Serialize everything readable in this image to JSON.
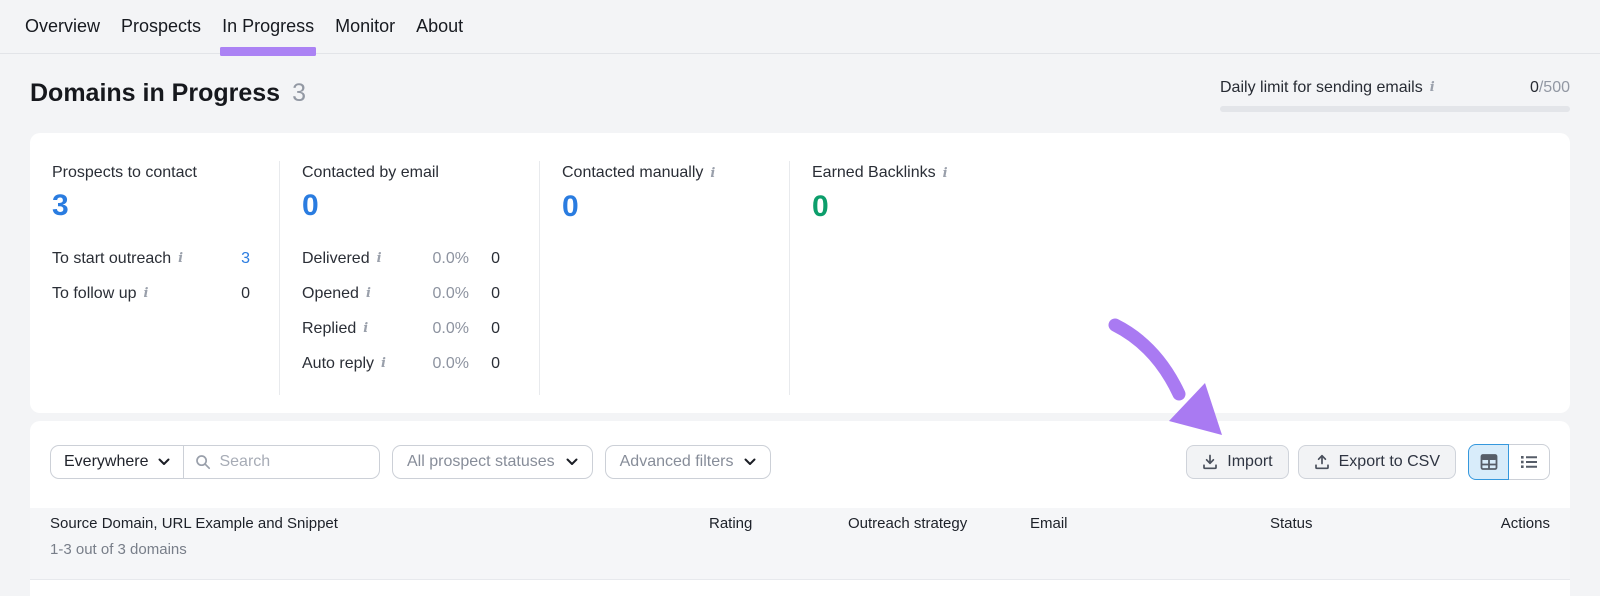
{
  "colors": {
    "accent_purple": "#a97af2",
    "stat_blue": "#2a7ce0",
    "stat_green": "#0c9e6b",
    "toggle_active_border": "#3598dd"
  },
  "nav": {
    "items": [
      {
        "label": "Overview"
      },
      {
        "label": "Prospects"
      },
      {
        "label": "In Progress"
      },
      {
        "label": "Monitor"
      },
      {
        "label": "About"
      }
    ],
    "active_index": 2
  },
  "header": {
    "title": "Domains in Progress",
    "count": "3"
  },
  "daily_limit": {
    "label": "Daily limit for sending emails",
    "used": "0",
    "quota": "/500"
  },
  "stats": {
    "col0": {
      "label": "Prospects to contact",
      "value": "3",
      "rows": [
        {
          "label": "To start outreach",
          "value": "3"
        },
        {
          "label": "To follow up",
          "value": "0"
        }
      ]
    },
    "col1": {
      "label": "Contacted by email",
      "value": "0",
      "rows": [
        {
          "label": "Delivered",
          "pct": "0.0%",
          "value": "0"
        },
        {
          "label": "Opened",
          "pct": "0.0%",
          "value": "0"
        },
        {
          "label": "Replied",
          "pct": "0.0%",
          "value": "0"
        },
        {
          "label": "Auto reply",
          "pct": "0.0%",
          "value": "0"
        }
      ]
    },
    "col2": {
      "label": "Contacted manually",
      "value": "0"
    },
    "col3": {
      "label": "Earned Backlinks",
      "value": "0"
    }
  },
  "toolbar": {
    "scope_label": "Everywhere",
    "search_placeholder": "Search",
    "status_filter_label": "All prospect statuses",
    "advanced_filters_label": "Advanced filters",
    "import_label": "Import",
    "export_label": "Export to CSV"
  },
  "table": {
    "columns": [
      "Source Domain, URL Example and Snippet",
      "Rating",
      "Outreach strategy",
      "Email",
      "Status",
      "Actions"
    ],
    "summary": "1-3 out of 3 domains"
  }
}
